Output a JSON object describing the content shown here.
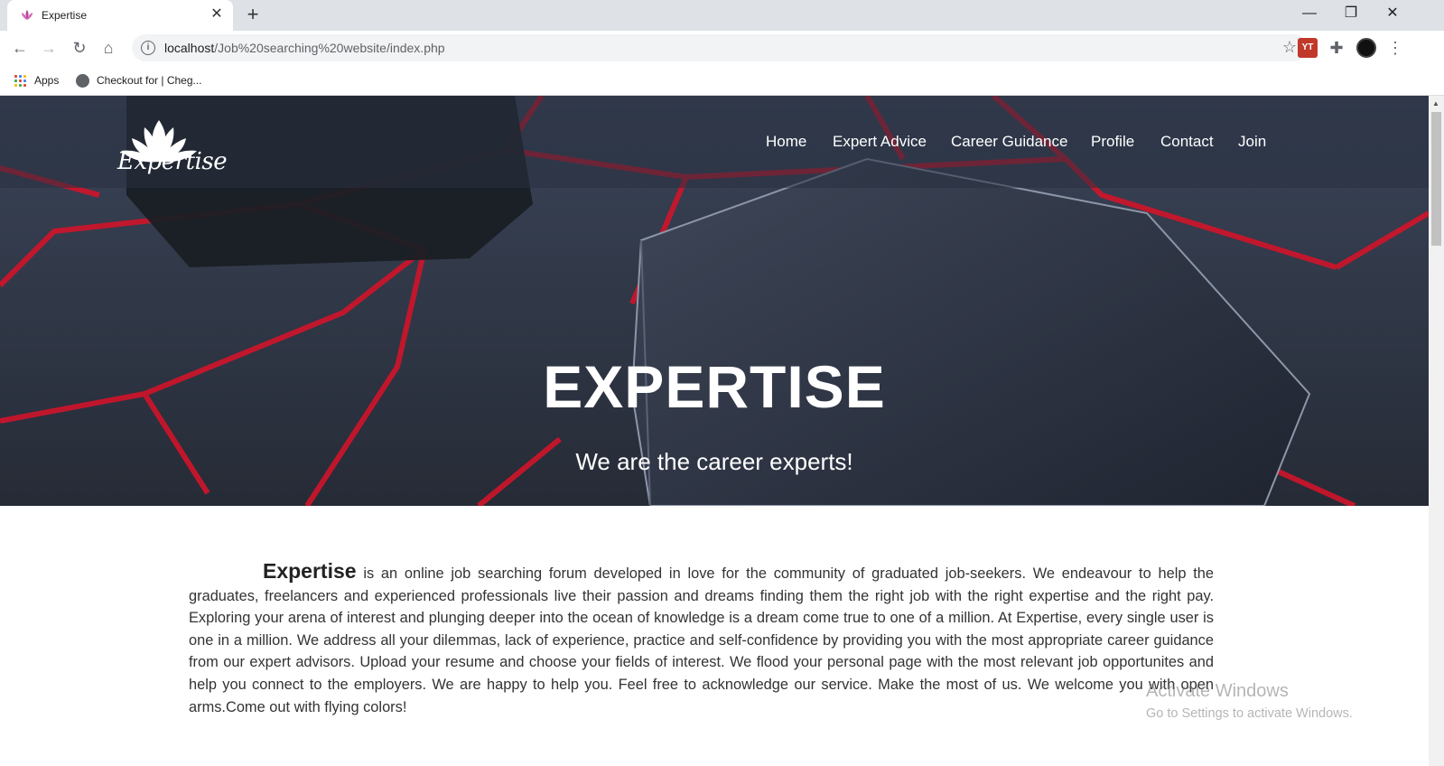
{
  "browser": {
    "tab_title": "Expertise",
    "url_host": "localhost",
    "url_path": "/Job%20searching%20website/index.php",
    "bookmarks": [
      {
        "label": "Apps",
        "icon": "apps-grid-icon"
      },
      {
        "label": "Checkout for | Cheg...",
        "icon": "globe-icon"
      }
    ],
    "window_controls": [
      "minimize",
      "restore",
      "close"
    ]
  },
  "site": {
    "logo_text": "Expertise",
    "nav": [
      {
        "label": "Home"
      },
      {
        "label": "Expert Advice"
      },
      {
        "label": "Career Guidance"
      },
      {
        "label": "Profile"
      },
      {
        "label": "Contact"
      },
      {
        "label": "Join"
      }
    ],
    "hero_title": "EXPERTISE",
    "hero_subtitle": "We are the career experts!",
    "about_brand": "Expertise",
    "about_text": " is an online job searching forum developed in love for the community of graduated job-seekers. We endeavour to help the graduates, freelancers and experienced professionals live their passion and dreams finding them the right job with the right expertise and the right pay. Exploring your arena of interest and plunging deeper into the ocean of knowledge is a dream come true to one of a million. At Expertise, every single user is one in a million. We address all your dilemmas, lack of experience, practice and self-confidence by providing you with the most appropriate career guidance from our expert advisors. Upload your resume and choose your fields of interest. We flood your personal page with the most relevant job opportunites and help you connect to the employers. We are happy to help you. Feel free to acknowledge our service. Make the most of us. We welcome you with open arms.Come out with flying colors!"
  },
  "os_watermark": {
    "line1": "Activate Windows",
    "line2": "Go to Settings to activate Windows."
  },
  "colors": {
    "hero_bg": "#2a3040",
    "accent_red": "#d0142a"
  }
}
